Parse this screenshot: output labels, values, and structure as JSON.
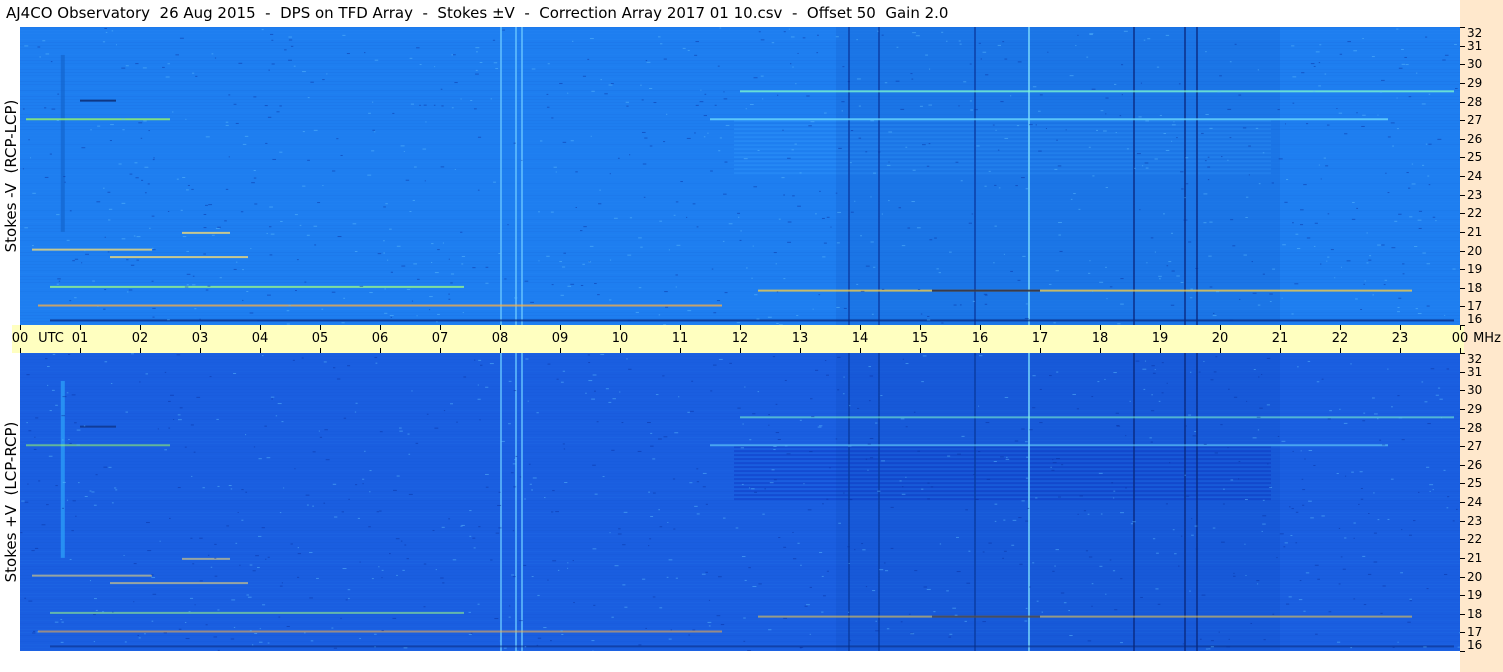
{
  "title": "AJ4CO Observatory  26 Aug 2015  -  DPS on TFD Array  -  Stokes ±V  -  Correction Array 2017 01 10.csv  -  Offset 50  Gain 2.0",
  "colors": {
    "utc_bar": "#ffffc0",
    "right_strip": "#ffe8cc",
    "top_base": "#1e7ef0",
    "bottom_base": "#1a5ee0"
  },
  "chart_data": [
    {
      "type": "heatmap",
      "panel": "top",
      "ylabel": "Stokes -V  (RCP-LCP)",
      "xlabel": "UTC",
      "yunit": "MHz",
      "x_start_hour": 0,
      "x_end_hour": 24,
      "ylim": [
        16,
        32
      ],
      "yticks": [
        16,
        17,
        18,
        19,
        20,
        21,
        22,
        23,
        24,
        25,
        26,
        27,
        28,
        29,
        30,
        31,
        32
      ]
    },
    {
      "type": "heatmap",
      "panel": "bottom",
      "ylabel": "Stokes +V  (LCP-RCP)",
      "xlabel": "UTC",
      "yunit": "MHz",
      "x_start_hour": 0,
      "x_end_hour": 24,
      "ylim": [
        16,
        32
      ],
      "yticks": [
        16,
        17,
        18,
        19,
        20,
        21,
        22,
        23,
        24,
        25,
        26,
        27,
        28,
        29,
        30,
        31,
        32
      ]
    }
  ],
  "utc_axis": {
    "labels": [
      "00",
      "01",
      "02",
      "03",
      "04",
      "05",
      "06",
      "07",
      "08",
      "09",
      "10",
      "11",
      "12",
      "13",
      "14",
      "15",
      "16",
      "17",
      "18",
      "19",
      "20",
      "21",
      "22",
      "23",
      "00"
    ],
    "utc_label": "UTC",
    "mhz_label": "MHz"
  }
}
